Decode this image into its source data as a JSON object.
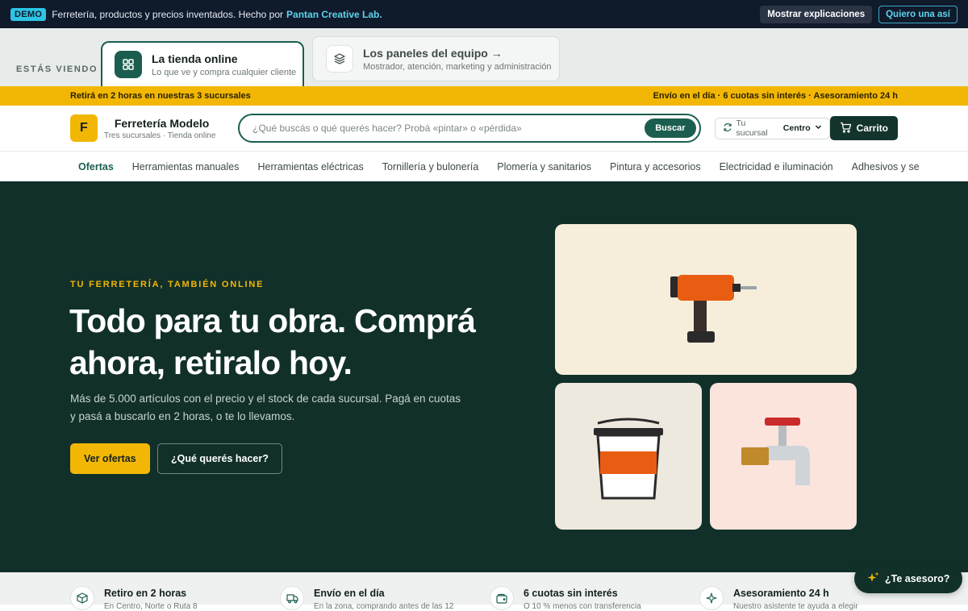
{
  "demo_bar": {
    "badge": "DEMO",
    "text": "Ferretería, productos y precios inventados. Hecho por",
    "link": "Pantan Creative Lab.",
    "show_explanations": "Mostrar explicaciones",
    "want_this": "Quiero una así"
  },
  "viewing": {
    "label": "ESTÁS VIENDO",
    "tabs": [
      {
        "title": "La tienda online",
        "subtitle": "Lo que ve y compra cualquier cliente",
        "icon": "grid-icon"
      },
      {
        "title": "Los paneles del equipo →",
        "subtitle": "Mostrador, atención, marketing y administración",
        "icon": "layers-icon"
      }
    ]
  },
  "promo": {
    "left": "Retirá en 2 horas en nuestras 3 sucursales",
    "right": "Envío en el día · 6 cuotas sin interés · Asesoramiento 24 h"
  },
  "header": {
    "logo_letter": "F",
    "store_name": "Ferretería Modelo",
    "store_sub": "Tres sucursales · Tienda online",
    "search_placeholder": "¿Qué buscás o qué querés hacer? Probá «pintar» o «pérdida»",
    "search_button": "Buscar",
    "branch_label": "Tu sucursal",
    "branch_value": "Centro",
    "cart_label": "Carrito"
  },
  "categories": [
    "Ofertas",
    "Herramientas manuales",
    "Herramientas eléctricas",
    "Tornillería y bulonería",
    "Plomería y sanitarios",
    "Pintura y accesorios",
    "Electricidad e iluminación",
    "Adhesivos y se"
  ],
  "hero": {
    "eyebrow": "TU FERRETERÍA, TAMBIÉN ONLINE",
    "title": "Todo para tu obra. Comprá ahora, retiralo hoy.",
    "description": "Más de 5.000 artículos con el precio y el stock de cada sucursal. Pagá en cuotas y pasá a buscarlo en 2 horas, o te lo llevamos.",
    "primary_button": "Ver ofertas",
    "secondary_button": "¿Qué querés hacer?"
  },
  "features": [
    {
      "title": "Retiro en 2 horas",
      "subtitle": "En Centro, Norte o Ruta 8",
      "icon": "box-icon"
    },
    {
      "title": "Envío en el día",
      "subtitle": "En la zona, comprando antes de las 12",
      "icon": "truck-icon"
    },
    {
      "title": "6 cuotas sin interés",
      "subtitle": "O 10 % menos con transferencia",
      "icon": "wallet-icon"
    },
    {
      "title": "Asesoramiento 24 h",
      "subtitle": "Nuestro asistente te ayuda a elegir",
      "icon": "sparkle-icon"
    }
  ],
  "advisor": {
    "label": "¿Te asesoro?",
    "icon": "sparkle-icon"
  },
  "colors": {
    "brand_green": "#1b5e50",
    "hero_bg": "#12302a",
    "accent_yellow": "#f2b705",
    "demo_bg": "#0f1a2b"
  }
}
